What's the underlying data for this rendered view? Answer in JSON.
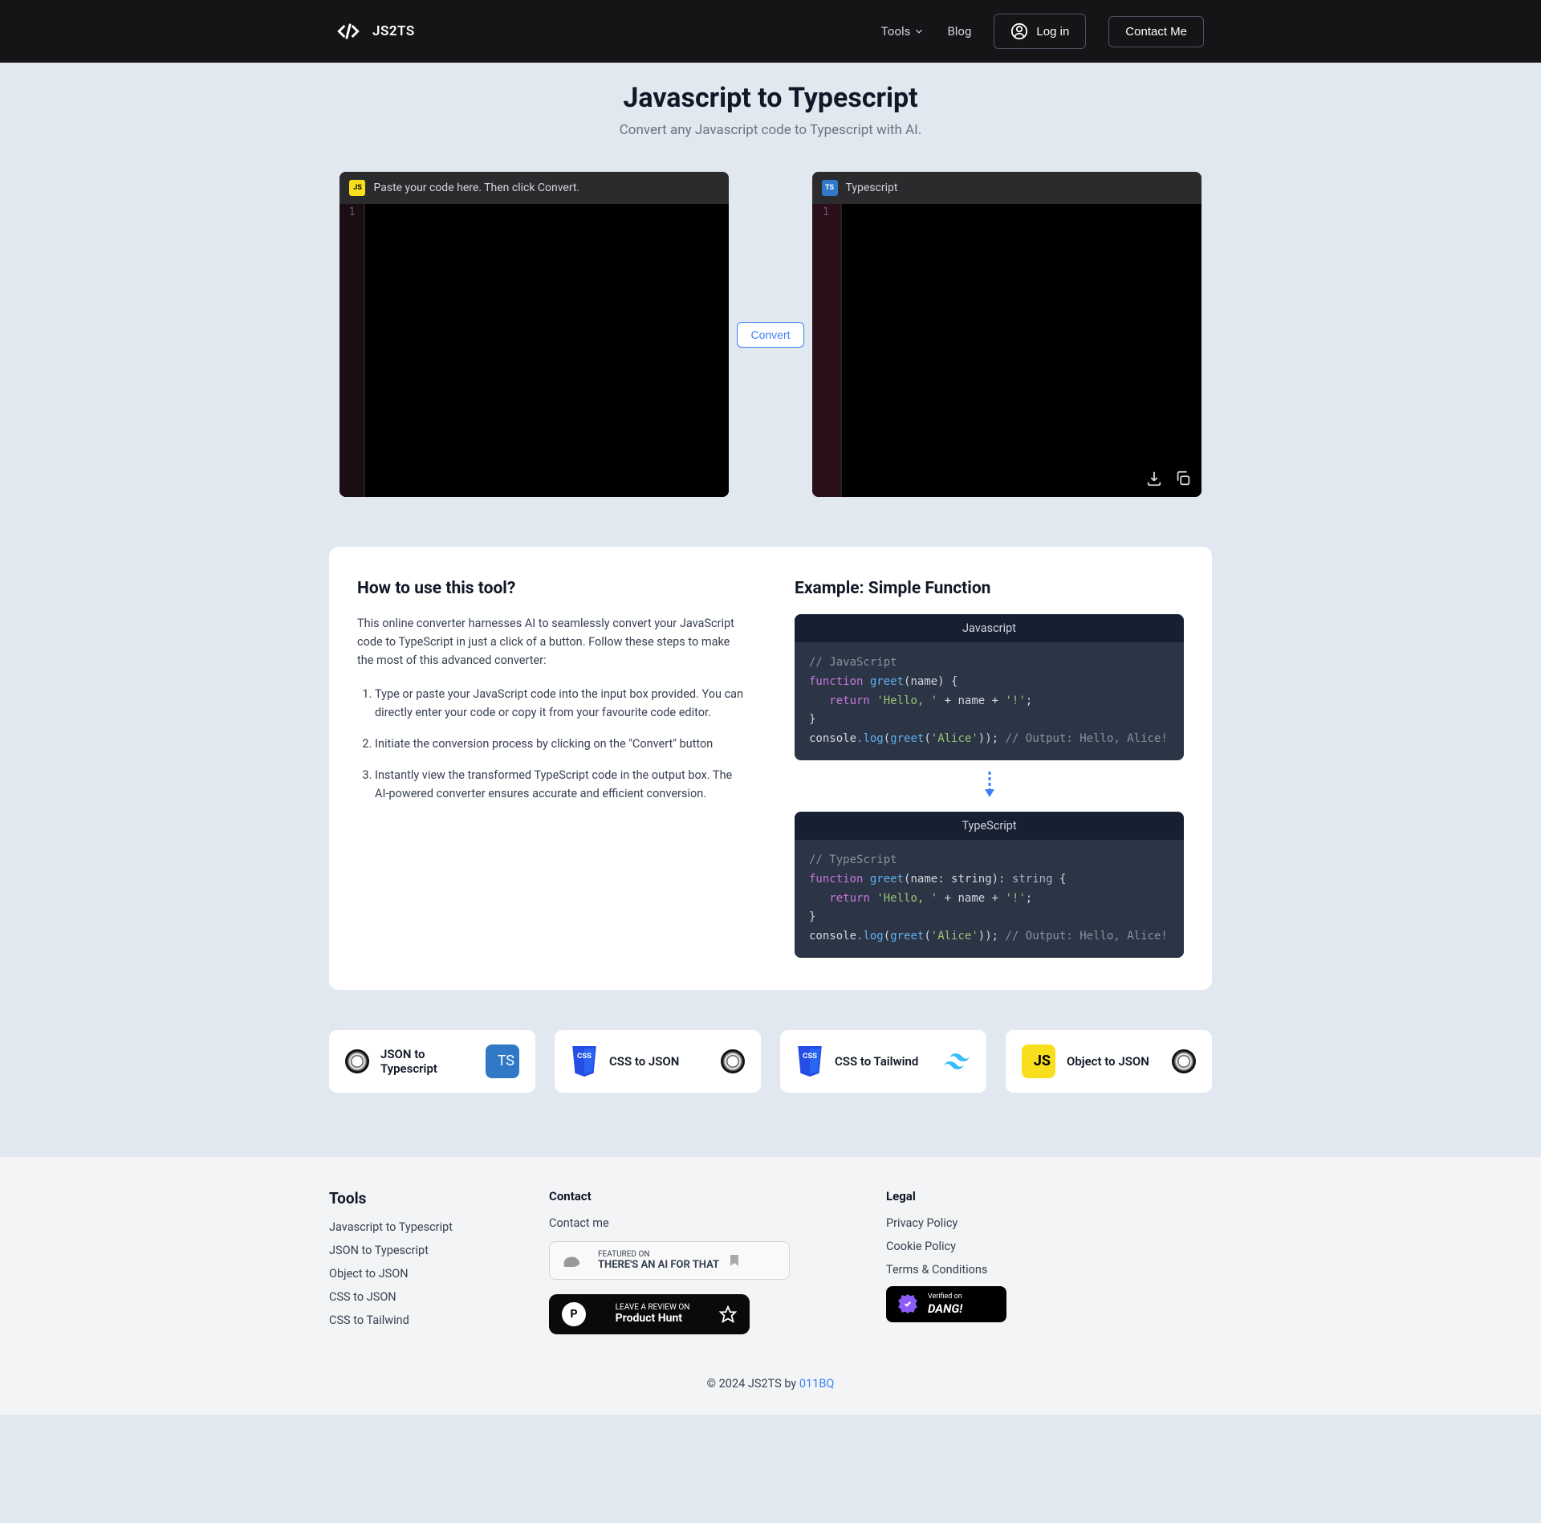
{
  "header": {
    "brand": "JS2TS",
    "nav": {
      "tools": "Tools",
      "blog": "Blog"
    },
    "login": "Log in",
    "contact": "Contact Me"
  },
  "hero": {
    "title": "Javascript to Typescript",
    "subtitle": "Convert any Javascript code to Typescript with AI."
  },
  "editors": {
    "input_hint": "Paste your code here. Then click Convert.",
    "output_label": "Typescript",
    "line1": "1"
  },
  "convert": "Convert",
  "howto": {
    "title": "How to use this tool?",
    "intro": "This online converter harnesses AI to seamlessly convert your JavaScript code to TypeScript in just a click of a button. Follow these steps to make the most of this advanced converter:",
    "steps": [
      "Type or paste your JavaScript code into the input box provided. You can directly enter your code or copy it from your favourite code editor.",
      "Initiate the conversion process by clicking on the \"Convert\" button",
      "Instantly view the transformed TypeScript code in the output box. The AI-powered converter ensures accurate and efficient conversion."
    ]
  },
  "example": {
    "title": "Example: Simple Function",
    "js_label": "Javascript",
    "ts_label": "TypeScript",
    "js_code": {
      "c1": "// JavaScript",
      "l2a": "function",
      "l2b": "greet",
      "l2c": "(name) {",
      "l3a": "return",
      "l3b": "'Hello, '",
      "l3c": " + ",
      "l3d": "name",
      "l3e": " + ",
      "l3f": "'!'",
      "l3g": ";",
      "l4": "}",
      "l5a": "console",
      "l5b": ".log",
      "l5c": "(",
      "l5d": "greet",
      "l5e": "(",
      "l5f": "'Alice'",
      "l5g": "));",
      "l5h": "  // Output: Hello, Alice!"
    },
    "ts_code": {
      "c1": "// TypeScript",
      "l2a": "function",
      "l2b": "greet",
      "l2c": "(name",
      "l2d": ": string",
      "l2e": "): ",
      "l2f": "string",
      "l2g": " {",
      "l3a": "return",
      "l3b": "'Hello, '",
      "l3c": " + ",
      "l3d": "name",
      "l3e": " + ",
      "l3f": "'!'",
      "l3g": ";",
      "l4": "}",
      "l5a": "console",
      "l5b": ".log",
      "l5c": "(",
      "l5d": "greet",
      "l5e": "(",
      "l5f": "'Alice'",
      "l5g": "));",
      "l5h": "  // Output: Hello, Alice!"
    }
  },
  "tools": [
    "JSON to Typescript",
    "CSS to JSON",
    "CSS to Tailwind",
    "Object to JSON"
  ],
  "footer": {
    "tools_heading": "Tools",
    "tools_links": [
      "Javascript to Typescript",
      "JSON to Typescript",
      "Object to JSON",
      "CSS to JSON",
      "CSS to Tailwind"
    ],
    "contact_heading": "Contact",
    "contact_me": "Contact me",
    "taaft_small": "FEATURED ON",
    "taaft_big": "THERE'S AN AI FOR THAT",
    "ph_small": "LEAVE A REVIEW ON",
    "ph_big": "Product Hunt",
    "legal_heading": "Legal",
    "legal_links": [
      "Privacy Policy",
      "Cookie Policy",
      "Terms & Conditions"
    ],
    "dang_small": "Verified on",
    "dang_big": "DANG!",
    "copyright_prefix": "© 2024 JS2TS by ",
    "copyright_link": "011BQ"
  }
}
